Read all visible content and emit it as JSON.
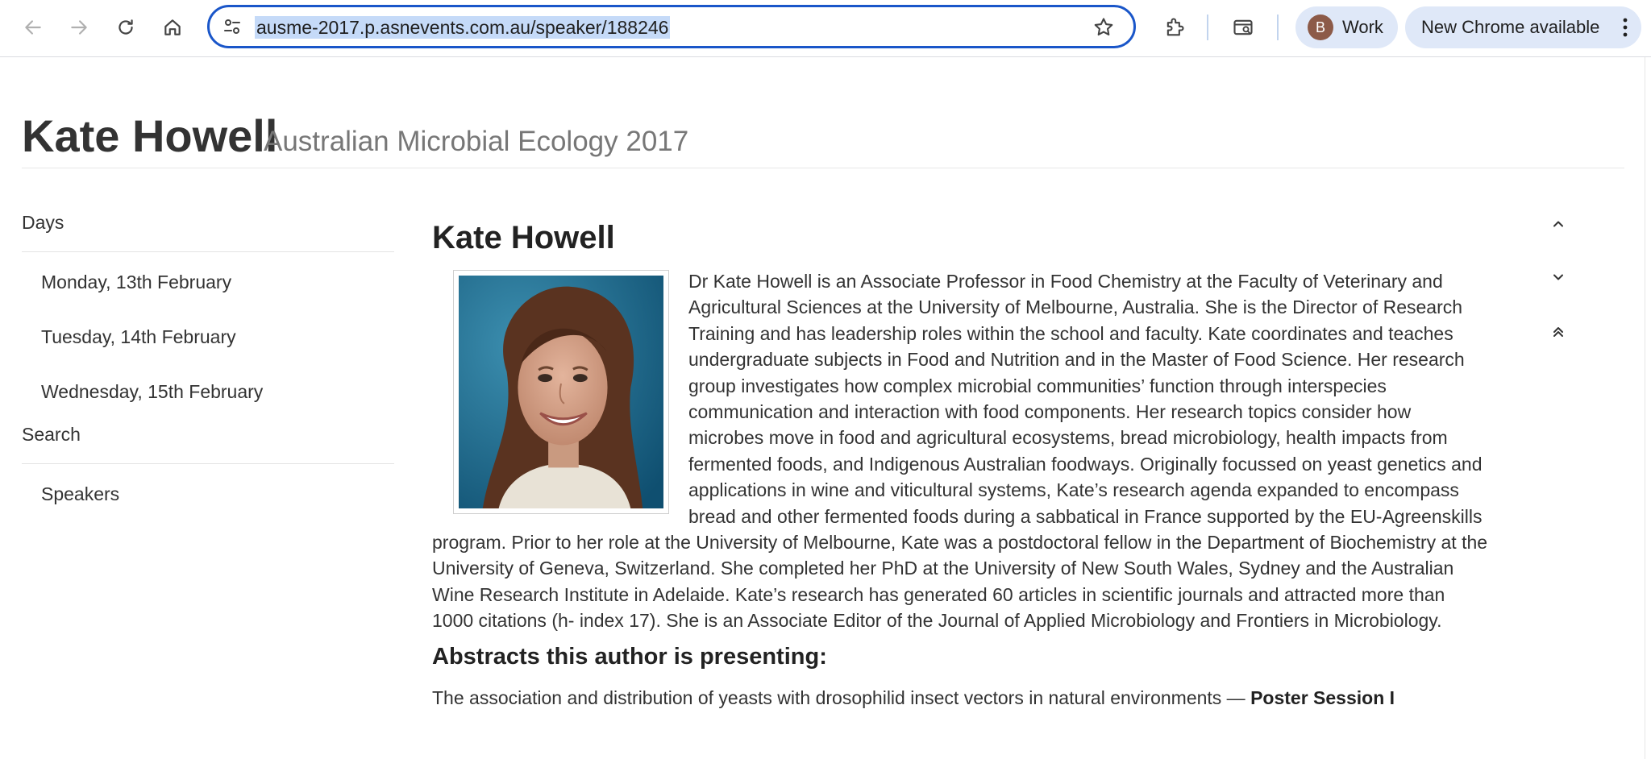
{
  "browser": {
    "url": "ausme-2017.p.asnevents.com.au/speaker/188246",
    "profile_initial": "B",
    "profile_name": "Work",
    "update_label": "New Chrome available"
  },
  "header": {
    "title": "Kate Howell",
    "subtitle": "Australian Microbial Ecology 2017"
  },
  "sidebar": {
    "days_heading": "Days",
    "days": [
      "Monday, 13th February",
      "Tuesday, 14th February",
      "Wednesday, 15th February"
    ],
    "search_heading": "Search",
    "search_items": [
      "Speakers"
    ]
  },
  "speaker": {
    "name": "Kate Howell",
    "bio": "Dr Kate Howell is an Associate Professor in Food Chemistry at the Faculty of Veterinary and Agricultural Sciences at the University of Melbourne, Australia. She is the Director of Research Training and has leadership roles within the school and faculty. Kate coordinates and teaches undergraduate subjects in Food and Nutrition and in the Master of Food Science. Her research group investigates how complex microbial communities’ function through interspecies communication and interaction with food components. Her research topics consider how microbes move in food and agricultural ecosystems, bread microbiology, health impacts from fermented foods, and Indigenous Australian foodways. Originally focussed on yeast genetics and applications in wine and viticultural systems, Kate’s research agenda expanded to encompass bread and other fermented foods during a sabbatical in France supported by the EU-Agreenskills program. Prior to her role at the University of Melbourne, Kate was a postdoctoral fellow in the Department of Biochemistry at the University of Geneva, Switzerland. She completed her PhD at the University of New South Wales, Sydney and the Australian Wine Research Institute in Adelaide. Kate’s research has generated 60 articles in scientific journals and attracted more than 1000 citations (h- index 17). She is an Associate Editor of the Journal of Applied Microbiology and Frontiers in Microbiology.",
    "abstracts_heading": "Abstracts this author is presenting:",
    "abstract_title": "The association and distribution of yeasts with drosophilid insect vectors in natural environments",
    "abstract_separator": " — ",
    "abstract_session": "Poster Session I"
  }
}
